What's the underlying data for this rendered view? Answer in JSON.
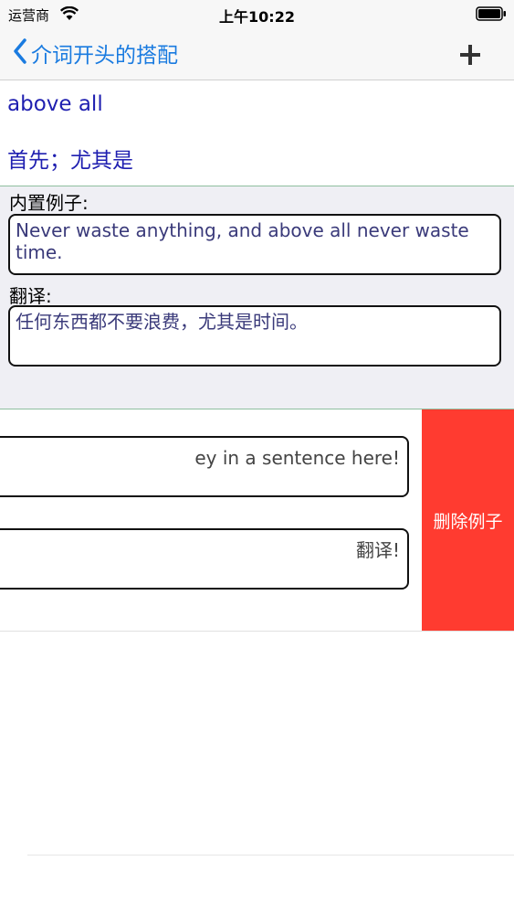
{
  "status_bar": {
    "carrier": "运营商",
    "time": "上午10:22"
  },
  "nav": {
    "back_label": "介词开头的搭配",
    "add_icon": "plus-icon",
    "back_icon": "chevron-left-icon"
  },
  "word": {
    "title": "above all",
    "meaning": "首先；尤其是"
  },
  "builtin": {
    "example_label": "内置例子:",
    "example_text": "Never waste anything, and above all never waste time.",
    "translation_label": "翻译:",
    "translation_text": "任何东西都不要浪费，尤其是时间。"
  },
  "user_example": {
    "example_placeholder_visible": "ey in a sentence here!",
    "translation_placeholder_visible": "翻译!",
    "delete_label": "删除例子"
  },
  "colors": {
    "accent": "#1a7be0",
    "word_text": "#1f1fb0",
    "delete": "#ff3b30",
    "section_bg": "#efeff4"
  }
}
